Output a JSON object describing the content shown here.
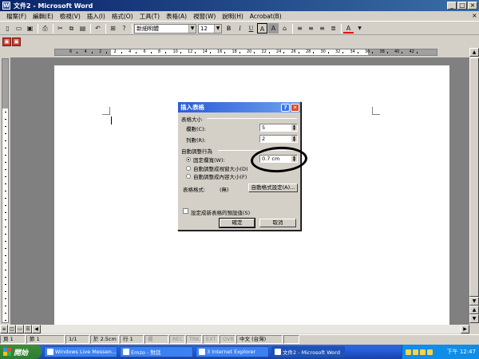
{
  "window": {
    "title": "文件2 - Microsoft Word",
    "app_icon": "W"
  },
  "menubar": {
    "items": [
      "檔案(F)",
      "編輯(E)",
      "檢視(V)",
      "插入(I)",
      "格式(O)",
      "工具(T)",
      "表格(A)",
      "視窗(W)",
      "說明(H)",
      "Acrobat(B)"
    ]
  },
  "toolbar": {
    "font_name": "新細明體",
    "font_size": "12",
    "icons": [
      "new-icon",
      "open-icon",
      "save-icon",
      "print-icon",
      "cut-icon",
      "copy-icon",
      "paste-icon",
      "undo-icon",
      "table-icon",
      "bold",
      "italic",
      "underline",
      "align-left-icon",
      "align-center-icon",
      "align-right-icon",
      "justify-icon",
      "font-color-icon"
    ],
    "bold_label": "B",
    "italic_label": "I",
    "underline_label": "U",
    "char_border_label": "A",
    "char_shade_label": "A",
    "font_color_label": "A"
  },
  "ruler": {
    "numbers": [
      "6",
      "4",
      "2",
      "2",
      "4",
      "6",
      "8",
      "10",
      "12",
      "14",
      "16",
      "18",
      "20",
      "22",
      "24",
      "26",
      "28",
      "30",
      "32",
      "34",
      "36",
      "38",
      "40",
      "42"
    ]
  },
  "dialog": {
    "title": "插入表格",
    "help_label": "?",
    "close_label": "✕",
    "group_size": "表格大小",
    "columns_label": "欄數(C):",
    "columns_value": "5",
    "rows_label": "列數(R):",
    "rows_value": "2",
    "group_autofit": "自動調整行為",
    "fixed_width_label": "固定欄寬(W):",
    "fixed_width_value": "0.7 cm",
    "autofit_window_label": "自動調整成視窗大小(D)",
    "autofit_content_label": "自動調整成內容大小(F)",
    "table_style_label": "表格格式:",
    "table_style_value": "(無)",
    "autoformat_button": "自動格式設定(A)...",
    "remember_label": "設定成新表格的預設值(S)",
    "ok_button": "確定",
    "cancel_button": "取消",
    "selected_option": "fixed_width"
  },
  "statusbar": {
    "page": "頁 1",
    "section": "節 1",
    "page_of": "1/1",
    "position": "於 2.5cm",
    "line": "行 1",
    "column": "欄",
    "rec": "REC",
    "trk": "TRK",
    "ext": "EXT",
    "ovr": "OVR",
    "language": "中文 (台灣)"
  },
  "taskbar": {
    "start_label": "開始",
    "buttons": [
      "Windows Live Messen...",
      "Emzo - 對話",
      "3 Internet Explorer",
      "文件2 - Microsoft Word"
    ],
    "clock": "下午 12:47"
  },
  "colors": {
    "title_bar": "#0a246a",
    "dialog_title": "#2a5bd7",
    "taskbar": "#245edb",
    "start_button": "#3c8d3c",
    "annotation_circle": "#000000"
  }
}
